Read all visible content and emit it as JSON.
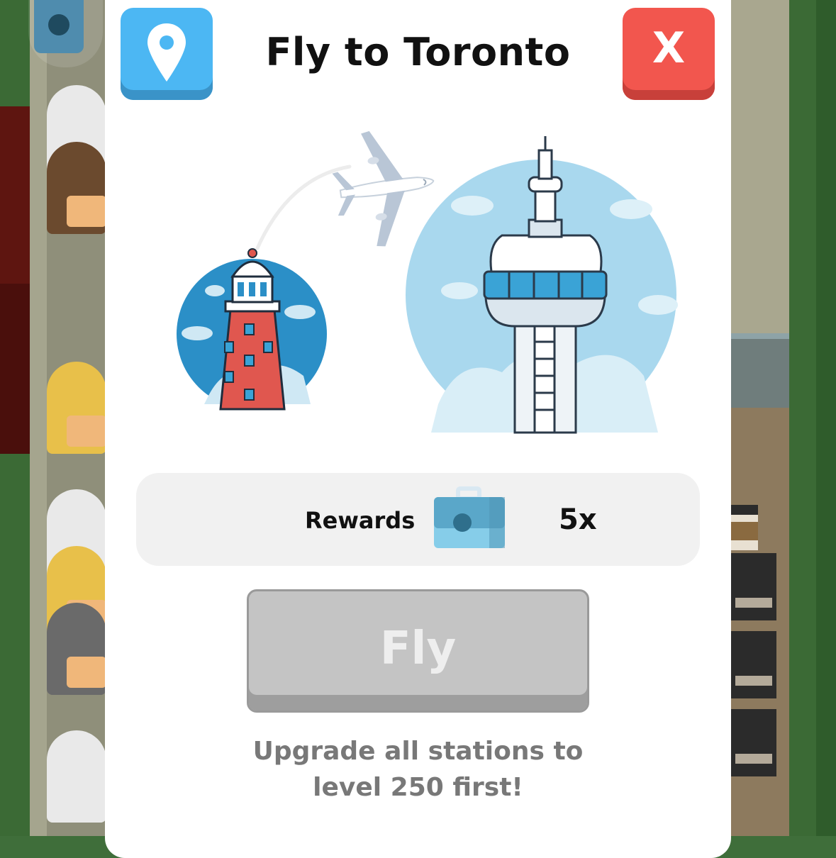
{
  "dialog": {
    "title": "Fly to Toronto",
    "close_label": "X",
    "location_icon": "map-pin-icon"
  },
  "illustration": {
    "origin_icon": "lighthouse-icon",
    "destination_icon": "cn-tower-icon",
    "plane_icon": "airplane-icon"
  },
  "rewards": {
    "label": "Rewards",
    "icon": "briefcase-chest-icon",
    "count": "5x"
  },
  "fly_button": {
    "label": "Fly",
    "enabled": false
  },
  "hint": {
    "line1": "Upgrade all stations to",
    "line2": "level 250 first!"
  },
  "colors": {
    "location_button": "#4cb7f3",
    "close_button": "#f2564e",
    "disabled_button": "#c4c4c4",
    "rewards_panel": "#f1f1f1"
  }
}
